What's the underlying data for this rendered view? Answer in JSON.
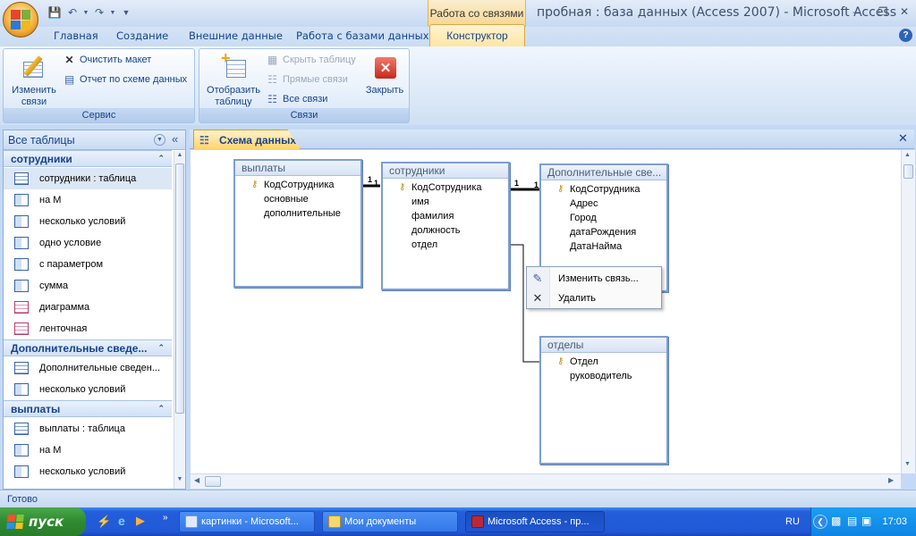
{
  "window": {
    "title": "пробная : база данных (Access 2007) - Microsoft Access",
    "context_tab_group": "Работа со связями"
  },
  "quick_access": [
    "save-icon",
    "undo-icon",
    "redo-icon",
    "customize-icon"
  ],
  "tabs": [
    {
      "label": "Главная"
    },
    {
      "label": "Создание"
    },
    {
      "label": "Внешние данные"
    },
    {
      "label": "Работа с базами данных"
    },
    {
      "label": "Конструктор",
      "active": true
    }
  ],
  "ribbon": {
    "service": {
      "label": "Сервис",
      "edit_relations": "Изменить связи",
      "clear_layout": "Очистить макет",
      "schema_report": "Отчет по схеме данных"
    },
    "relations": {
      "label": "Связи",
      "show_table": "Отобразить таблицу",
      "hide_table": "Скрыть таблицу",
      "direct_relations": "Прямые связи",
      "all_relations": "Все связи",
      "close": "Закрыть"
    }
  },
  "nav": {
    "header": "Все таблицы",
    "groups": [
      {
        "name": "сотрудники",
        "items": [
          {
            "label": "сотрудники : таблица",
            "type": "table"
          },
          {
            "label": "на М",
            "type": "query"
          },
          {
            "label": "несколько условий",
            "type": "query"
          },
          {
            "label": "одно условие",
            "type": "query"
          },
          {
            "label": "с параметром",
            "type": "query"
          },
          {
            "label": "сумма",
            "type": "query"
          },
          {
            "label": "диаграмма",
            "type": "form"
          },
          {
            "label": "ленточная",
            "type": "form"
          }
        ]
      },
      {
        "name": "Дополнительные сведе...",
        "items": [
          {
            "label": "Дополнительные сведен...",
            "type": "table"
          },
          {
            "label": "несколько условий",
            "type": "query"
          }
        ]
      },
      {
        "name": "выплаты",
        "items": [
          {
            "label": "выплаты : таблица",
            "type": "table"
          },
          {
            "label": "на М",
            "type": "query"
          },
          {
            "label": "несколько условий",
            "type": "query"
          }
        ]
      }
    ]
  },
  "document": {
    "tab": "Схема данных",
    "tables": [
      {
        "title": "выплаты",
        "fields": [
          "КодСотрудника",
          "основные",
          "дополнительные"
        ]
      },
      {
        "title": "сотрудники",
        "fields": [
          "КодСотрудника",
          "имя",
          "фамилия",
          "должность",
          "отдел"
        ]
      },
      {
        "title": "Дополнительные све...",
        "fields": [
          "КодСотрудника",
          "Адрес",
          "Город",
          "датаРождения",
          "ДатаНайма"
        ]
      },
      {
        "title": "отделы",
        "fields": [
          "Отдел",
          "руководитель"
        ]
      }
    ],
    "relation_labels": [
      "1",
      "1",
      "1",
      "1"
    ]
  },
  "context_menu": {
    "edit": "Изменить связь...",
    "delete": "Удалить"
  },
  "status": "Готово",
  "taskbar": {
    "start": "пуск",
    "tasks": [
      "картинки - Microsoft...",
      "Мои документы",
      "Microsoft Access - пр..."
    ],
    "lang": "RU",
    "clock": "17:03"
  }
}
